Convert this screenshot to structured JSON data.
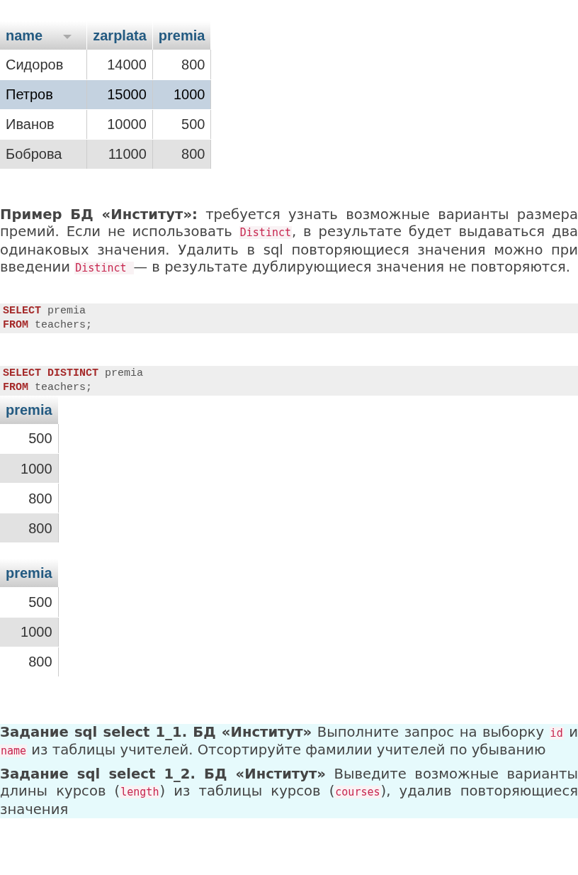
{
  "salary_table": {
    "columns": [
      {
        "label": "name",
        "sorted": true,
        "kind": "text"
      },
      {
        "label": "zarplata",
        "sorted": false,
        "kind": "number"
      },
      {
        "label": "premia",
        "sorted": false,
        "kind": "number"
      }
    ],
    "rows": [
      {
        "cells": [
          "Сидоров",
          "14000",
          "800"
        ],
        "selected": false
      },
      {
        "cells": [
          "Петров",
          "15000",
          "1000"
        ],
        "selected": true
      },
      {
        "cells": [
          "Иванов",
          "10000",
          "500"
        ],
        "selected": false
      },
      {
        "cells": [
          "Боброва",
          "11000",
          "800"
        ],
        "selected": false
      }
    ]
  },
  "example_paragraph": [
    {
      "kind": "bold",
      "text": "Пример БД «Институт»:"
    },
    {
      "kind": "text",
      "text": " требуется узнать возможные варианты размера премий. Если не использовать "
    },
    {
      "kind": "code",
      "text": "Distinct"
    },
    {
      "kind": "text",
      "text": ", в результате будет выдаваться два одинаковых значения. Удалить в sql повторяющиеся значения можно при введении "
    },
    {
      "kind": "code",
      "text": "Distinct "
    },
    {
      "kind": "text",
      "text": " — в результате дублирующиеся значения не повторяются."
    }
  ],
  "code_blocks": [
    {
      "lines": [
        [
          {
            "kind": "keyword",
            "text": "SELECT"
          },
          {
            "kind": "plain",
            "text": " premia"
          }
        ],
        [
          {
            "kind": "keyword",
            "text": "FROM"
          },
          {
            "kind": "plain",
            "text": " teachers;"
          }
        ]
      ]
    },
    {
      "lines": [
        [
          {
            "kind": "keyword",
            "text": "SELECT DISTINCT"
          },
          {
            "kind": "plain",
            "text": " premia"
          }
        ],
        [
          {
            "kind": "keyword",
            "text": "FROM"
          },
          {
            "kind": "plain",
            "text": " teachers;"
          }
        ]
      ]
    }
  ],
  "result_tables": [
    {
      "columns": [
        {
          "label": "premia",
          "sorted": false,
          "kind": "number"
        }
      ],
      "rows": [
        {
          "cells": [
            "500"
          ],
          "selected": false
        },
        {
          "cells": [
            "1000"
          ],
          "selected": false
        },
        {
          "cells": [
            "800"
          ],
          "selected": false
        },
        {
          "cells": [
            "800"
          ],
          "selected": false
        }
      ]
    },
    {
      "columns": [
        {
          "label": "premia",
          "sorted": false,
          "kind": "number"
        }
      ],
      "rows": [
        {
          "cells": [
            "500"
          ],
          "selected": false
        },
        {
          "cells": [
            "1000"
          ],
          "selected": false
        },
        {
          "cells": [
            "800"
          ],
          "selected": false
        }
      ]
    }
  ],
  "tasks": [
    [
      {
        "kind": "bold",
        "text": "Задание sql select 1_1. БД «Институт»"
      },
      {
        "kind": "text",
        "text": " Выполните запрос на выборку "
      },
      {
        "kind": "code",
        "text": "id"
      },
      {
        "kind": "text",
        "text": " и "
      },
      {
        "kind": "code",
        "text": "name"
      },
      {
        "kind": "text",
        "text": " из таблицы учителей. Отсортируйте фамилии учителей по убыванию"
      }
    ],
    [
      {
        "kind": "bold",
        "text": "Задание sql select 1_2. БД «Институт»"
      },
      {
        "kind": "text",
        "text": " Выведите возможные варианты длины курсов ("
      },
      {
        "kind": "code",
        "text": "length"
      },
      {
        "kind": "text",
        "text": ") из таблицы курсов ("
      },
      {
        "kind": "code",
        "text": "courses"
      },
      {
        "kind": "text",
        "text": "), удалив повторяющиеся значения"
      }
    ]
  ]
}
